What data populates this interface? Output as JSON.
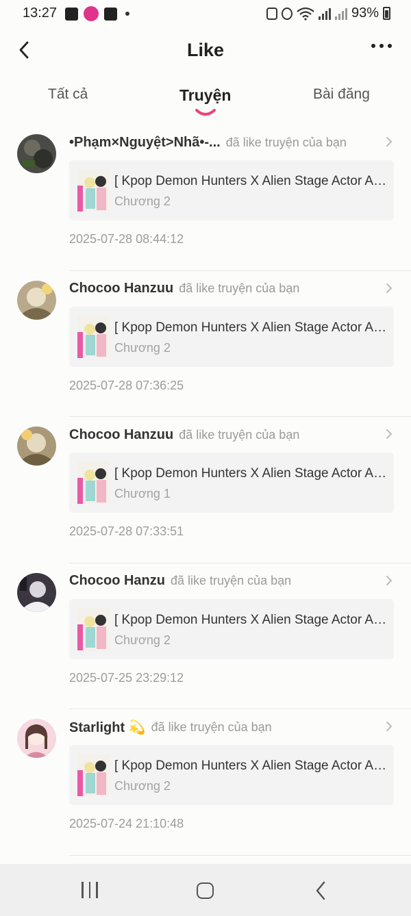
{
  "status_bar": {
    "time": "13:27",
    "battery": "93%"
  },
  "header": {
    "title": "Like"
  },
  "tabs": [
    {
      "label": "Tất cả",
      "active": false
    },
    {
      "label": "Truyện",
      "active": true
    },
    {
      "label": "Bài đăng",
      "active": false
    }
  ],
  "accent_color": "#e8457a",
  "notifications": [
    {
      "user": "•Phạm×Nguyệt>Nhã•-...",
      "action": "đã like truyện của bạn",
      "story_title": "[ Kpop Demon Hunters X Alien Stage Actor Au...",
      "chapter": "Chương 2",
      "timestamp": "2025-07-28 08:44:12"
    },
    {
      "user": "Chocoo Hanzuu",
      "action": "đã like truyện của bạn",
      "story_title": "[ Kpop Demon Hunters X Alien Stage Actor Au...",
      "chapter": "Chương 2",
      "timestamp": "2025-07-28 07:36:25"
    },
    {
      "user": "Chocoo Hanzuu",
      "action": "đã like truyện của bạn",
      "story_title": "[ Kpop Demon Hunters X Alien Stage Actor Au...",
      "chapter": "Chương 1",
      "timestamp": "2025-07-28 07:33:51"
    },
    {
      "user": "Chocoo Hanzu",
      "action": "đã like truyện của bạn",
      "story_title": "[ Kpop Demon Hunters X Alien Stage Actor Au...",
      "chapter": "Chương 2",
      "timestamp": "2025-07-25 23:29:12"
    },
    {
      "user": "Starlight 💫",
      "action": "đã like truyện của bạn",
      "story_title": "[ Kpop Demon Hunters X Alien Stage Actor Au...",
      "chapter": "Chương 2",
      "timestamp": "2025-07-24 21:10:48"
    }
  ]
}
